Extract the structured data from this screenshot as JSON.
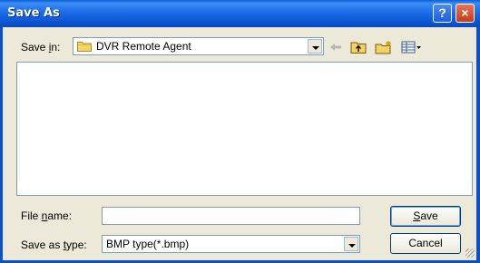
{
  "window": {
    "title": "Save As",
    "help_label": "?",
    "close_label": "×"
  },
  "toolbar": {
    "save_in_pre": "Save ",
    "save_in_key": "i",
    "save_in_post": "n:",
    "location_value": "DVR Remote Agent",
    "icons": [
      "back-arrow-icon",
      "up-folder-icon",
      "new-folder-icon",
      "view-menu-icon"
    ]
  },
  "form": {
    "filename_pre": "File ",
    "filename_key": "n",
    "filename_post": "ame:",
    "filename_value": "",
    "type_pre": "Save as ",
    "type_key": "t",
    "type_post": "ype:",
    "type_value": "BMP type(*.bmp)"
  },
  "buttons": {
    "save_key": "S",
    "save_rest": "ave",
    "cancel_label": "Cancel"
  },
  "colors": {
    "titlebar": "#0a5fd8",
    "dialog_bg": "#ece9d8",
    "close_button": "#c43c17"
  }
}
